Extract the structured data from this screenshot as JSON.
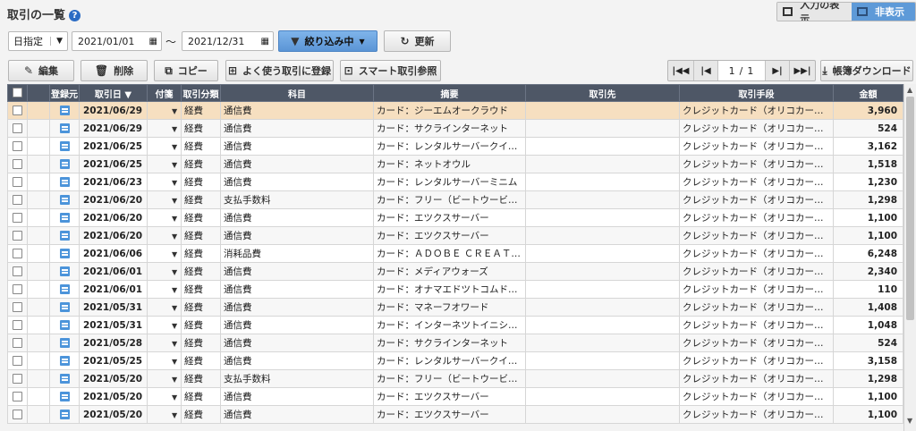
{
  "page": {
    "title": "取引の一覧",
    "help": "?"
  },
  "view_toggle": {
    "show_input": "入力の表示",
    "hide": "非表示"
  },
  "filter": {
    "date_mode": "日指定",
    "start_date": "2021/01/01",
    "separator": "〜",
    "end_date": "2021/12/31",
    "filter_label": "絞り込み中",
    "refresh_label": "更新"
  },
  "toolbar": {
    "edit": "編集",
    "delete": "削除",
    "copy": "コピー",
    "frequent": "よく使う取引に登録",
    "smart": "スマート取引参照",
    "download": "帳簿ダウンロード"
  },
  "pager": {
    "current": "1",
    "sep": "/",
    "total": "1"
  },
  "columns": {
    "registered": "登録元",
    "date": "取引日 ▼",
    "tag": "付箋",
    "category": "取引分類",
    "account": "科目",
    "description": "摘要",
    "partner": "取引先",
    "method": "取引手段",
    "amount": "金額"
  },
  "rows": [
    {
      "date": "2021/06/29",
      "category": "経費",
      "account": "通信費",
      "description": "カード：ジーエムオークラウド",
      "partner": "",
      "method": "クレジットカード（オリコカード）",
      "amount": "3,960"
    },
    {
      "date": "2021/06/29",
      "category": "経費",
      "account": "通信費",
      "description": "カード：サクラインターネット",
      "partner": "",
      "method": "クレジットカード（オリコカード）",
      "amount": "524"
    },
    {
      "date": "2021/06/25",
      "category": "経費",
      "account": "通信費",
      "description": "カード：レンタルサーバークイツカ",
      "partner": "",
      "method": "クレジットカード（オリコカード）",
      "amount": "3,162"
    },
    {
      "date": "2021/06/25",
      "category": "経費",
      "account": "通信費",
      "description": "カード：ネットオウル",
      "partner": "",
      "method": "クレジットカード（オリコカード）",
      "amount": "1,518"
    },
    {
      "date": "2021/06/23",
      "category": "経費",
      "account": "通信費",
      "description": "カード：レンタルサーバーミニム",
      "partner": "",
      "method": "クレジットカード（オリコカード）",
      "amount": "1,230"
    },
    {
      "date": "2021/06/20",
      "category": "経費",
      "account": "支払手数料",
      "description": "カード：フリー（ビートウービー）",
      "partner": "",
      "method": "クレジットカード（オリコカード）",
      "amount": "1,298"
    },
    {
      "date": "2021/06/20",
      "category": "経費",
      "account": "通信費",
      "description": "カード：エツクスサーバー",
      "partner": "",
      "method": "クレジットカード（オリコカード）",
      "amount": "1,100"
    },
    {
      "date": "2021/06/20",
      "category": "経費",
      "account": "通信費",
      "description": "カード：エツクスサーバー",
      "partner": "",
      "method": "クレジットカード（オリコカード）",
      "amount": "1,100"
    },
    {
      "date": "2021/06/06",
      "category": "経費",
      "account": "消耗品費",
      "description": "カード：ＡＤＯＢＥ ＣＲＥＡＴＩ…",
      "partner": "",
      "method": "クレジットカード（オリコカード）",
      "amount": "6,248"
    },
    {
      "date": "2021/06/01",
      "category": "経費",
      "account": "通信費",
      "description": "カード：メディアウォーズ",
      "partner": "",
      "method": "クレジットカード（オリコカード）",
      "amount": "2,340"
    },
    {
      "date": "2021/06/01",
      "category": "経費",
      "account": "通信費",
      "description": "カード：オナマエドツトコムドメイン",
      "partner": "",
      "method": "クレジットカード（オリコカード）",
      "amount": "110"
    },
    {
      "date": "2021/05/31",
      "category": "経費",
      "account": "通信費",
      "description": "カード：マネーフオワード",
      "partner": "",
      "method": "クレジットカード（オリコカード）",
      "amount": "1,408"
    },
    {
      "date": "2021/05/31",
      "category": "経費",
      "account": "通信費",
      "description": "カード：インターネツトイニシアテ…",
      "partner": "",
      "method": "クレジットカード（オリコカード）",
      "amount": "1,048"
    },
    {
      "date": "2021/05/28",
      "category": "経費",
      "account": "通信費",
      "description": "カード：サクラインターネット",
      "partner": "",
      "method": "クレジットカード（オリコカード）",
      "amount": "524"
    },
    {
      "date": "2021/05/25",
      "category": "経費",
      "account": "通信費",
      "description": "カード：レンタルサーバークイツカ",
      "partner": "",
      "method": "クレジットカード（オリコカード）",
      "amount": "3,158"
    },
    {
      "date": "2021/05/20",
      "category": "経費",
      "account": "支払手数料",
      "description": "カード：フリー（ビートウービー）",
      "partner": "",
      "method": "クレジットカード（オリコカード）",
      "amount": "1,298"
    },
    {
      "date": "2021/05/20",
      "category": "経費",
      "account": "通信費",
      "description": "カード：エツクスサーバー",
      "partner": "",
      "method": "クレジットカード（オリコカード）",
      "amount": "1,100"
    },
    {
      "date": "2021/05/20",
      "category": "経費",
      "account": "通信費",
      "description": "カード：エツクスサーバー",
      "partner": "",
      "method": "クレジットカード（オリコカード）",
      "amount": "1,100"
    }
  ],
  "icons": {
    "help": "question-icon",
    "calendar": "calendar-icon",
    "filter": "funnel-icon",
    "refresh": "refresh-icon",
    "edit": "pencil-icon",
    "delete": "trash-icon",
    "copy": "copy-icon",
    "frequent": "bookmark-add-icon",
    "smart": "smart-search-icon",
    "download": "download-icon",
    "registered": "document-icon"
  },
  "colors": {
    "header_bg": "#4e5766",
    "selected_row": "#f6dfc0",
    "accent": "#5e9ad8"
  }
}
